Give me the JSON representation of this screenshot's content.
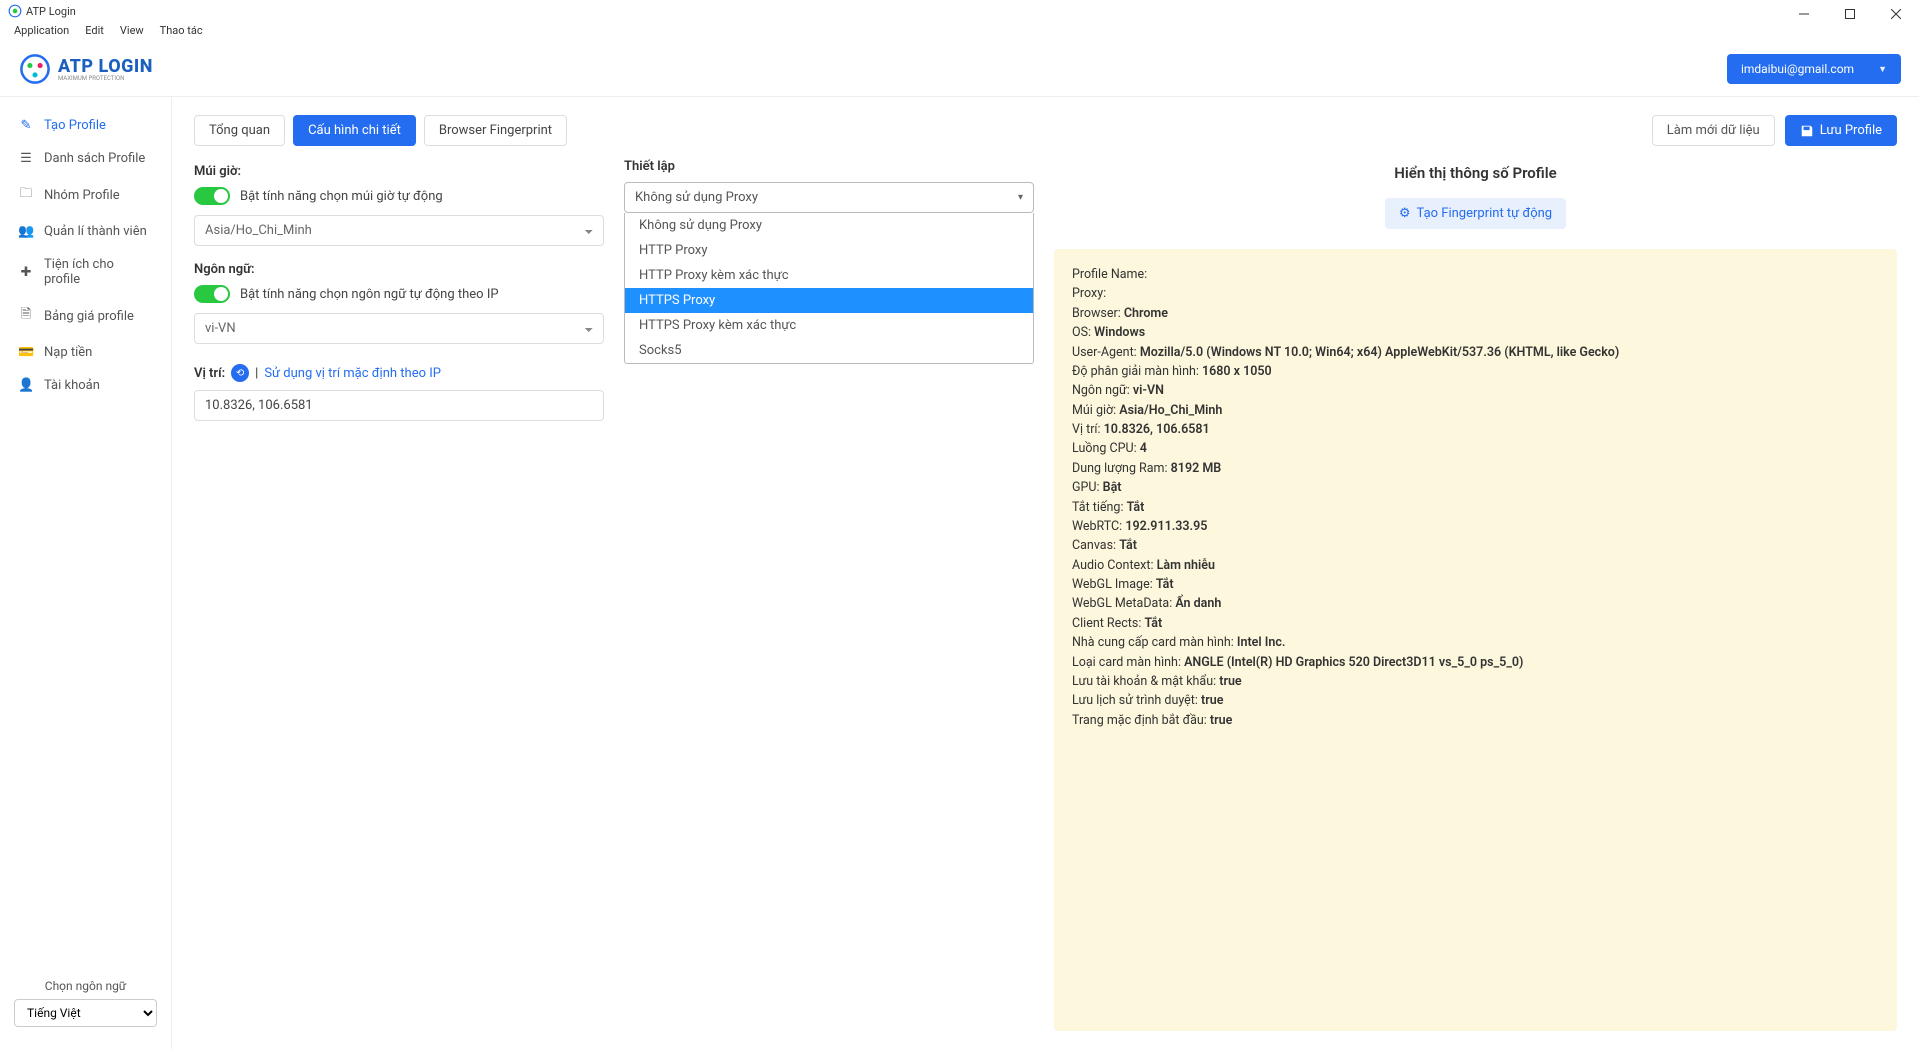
{
  "window": {
    "title": "ATP Login"
  },
  "menubar": [
    "Application",
    "Edit",
    "View",
    "Thao tác"
  ],
  "logo": {
    "main": "ATP LOGIN",
    "sub": "MAXIMUM PROTECTION"
  },
  "user_email": "imdaibui@gmail.com",
  "sidebar": {
    "items": [
      {
        "label": "Tạo Profile",
        "icon": "✎"
      },
      {
        "label": "Danh sách Profile",
        "icon": "☰"
      },
      {
        "label": "Nhóm Profile",
        "icon": "🗀"
      },
      {
        "label": "Quản lí thành viên",
        "icon": "👥"
      },
      {
        "label": "Tiện ích cho profile",
        "icon": "✚"
      },
      {
        "label": "Bảng giá profile",
        "icon": "🗎"
      },
      {
        "label": "Nạp tiền",
        "icon": "💳"
      },
      {
        "label": "Tài khoản",
        "icon": "👤"
      }
    ],
    "lang_label": "Chọn ngôn ngữ",
    "lang_value": "Tiếng Việt"
  },
  "tabs": {
    "t0": "Tổng quan",
    "t1": "Cấu hình chi tiết",
    "t2": "Browser Fingerprint"
  },
  "actions": {
    "refresh": "Làm mới dữ liệu",
    "save": "Lưu Profile"
  },
  "form": {
    "tz_label": "Múi giờ:",
    "tz_toggle": "Bật tính năng chọn múi giờ tự động",
    "tz_value": "Asia/Ho_Chi_Minh",
    "lang_label": "Ngôn ngữ:",
    "lang_toggle": "Bật tính năng chọn ngôn ngữ tự động theo IP",
    "lang_value": "vi-VN",
    "loc_label": "Vị trí:",
    "loc_sep": "|",
    "loc_link": "Sử dụng vị trí mặc định theo IP",
    "loc_value": "10.8326, 106.6581",
    "proxy_label": "Thiết lập",
    "proxy_selected": "Không sử dụng Proxy",
    "proxy_options": [
      "Không sử dụng Proxy",
      "HTTP Proxy",
      "HTTP Proxy kèm xác thực",
      "HTTPS Proxy",
      "HTTPS Proxy kèm xác thực",
      "Socks5"
    ]
  },
  "right": {
    "header": "Hiển thị thông số Profile",
    "fingerprint_btn": "Tạo Fingerprint tự động"
  },
  "profile": {
    "rows": [
      {
        "label": "Profile Name: ",
        "value": ""
      },
      {
        "label": "Proxy: ",
        "value": ""
      },
      {
        "label": "Browser: ",
        "value": "Chrome"
      },
      {
        "label": "OS: ",
        "value": "Windows"
      },
      {
        "label": "User-Agent: ",
        "value": "Mozilla/5.0 (Windows NT 10.0; Win64; x64) AppleWebKit/537.36 (KHTML, like Gecko)"
      },
      {
        "label": "Độ phân giải màn hình: ",
        "value": "1680 x 1050"
      },
      {
        "label": "Ngôn ngữ: ",
        "value": "vi-VN"
      },
      {
        "label": "Múi giờ: ",
        "value": "Asia/Ho_Chi_Minh"
      },
      {
        "label": "Vị trí: ",
        "value": "10.8326, 106.6581"
      },
      {
        "label": "Luồng CPU: ",
        "value": "4"
      },
      {
        "label": "Dung lượng Ram: ",
        "value": "8192 MB"
      },
      {
        "label": "GPU: ",
        "value": "Bật"
      },
      {
        "label": "Tắt tiếng: ",
        "value": "Tắt"
      },
      {
        "label": "WebRTC: ",
        "value": "192.911.33.95"
      },
      {
        "label": "Canvas: ",
        "value": "Tắt"
      },
      {
        "label": "Audio Context: ",
        "value": "Làm nhiễu"
      },
      {
        "label": "WebGL Image: ",
        "value": "Tắt"
      },
      {
        "label": "WebGL MetaData: ",
        "value": "Ẩn danh"
      },
      {
        "label": "Client Rects: ",
        "value": "Tắt"
      },
      {
        "label": "Nhà cung cấp card màn hình: ",
        "value": "Intel Inc."
      },
      {
        "label": "Loại card màn hình: ",
        "value": "ANGLE (Intel(R) HD Graphics 520 Direct3D11 vs_5_0 ps_5_0)"
      },
      {
        "label": "Lưu tài khoản & mật khẩu: ",
        "value": "true"
      },
      {
        "label": "Lưu lịch sử trình duyệt: ",
        "value": "true"
      },
      {
        "label": "Trang mặc định bắt đầu: ",
        "value": "true"
      }
    ]
  }
}
